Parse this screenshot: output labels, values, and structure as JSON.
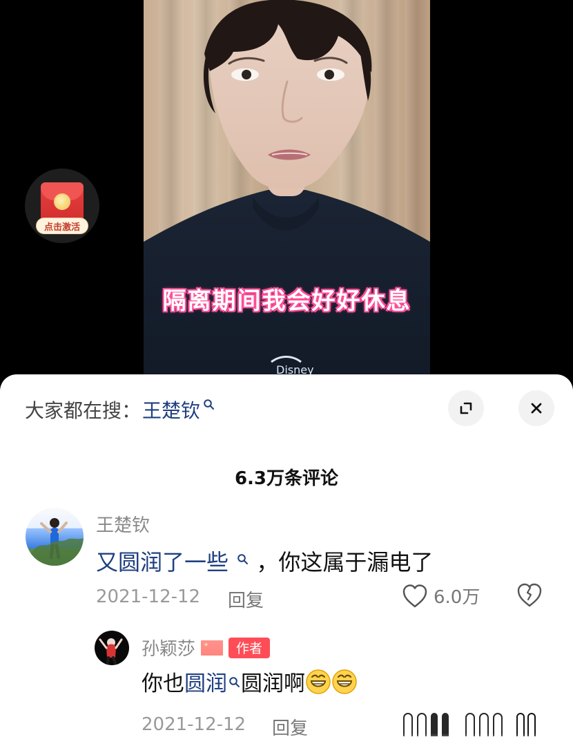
{
  "video": {
    "caption": "隔离期间我会好好休息"
  },
  "red_packet": {
    "label": "点击激活"
  },
  "panel": {
    "search_prefix": "大家都在搜：",
    "search_term": "王楚钦",
    "comment_count": "6.3万条评论"
  },
  "comment": {
    "username": "王楚钦",
    "highlight": "又圆润了一些",
    "rest": "，你这属于漏电了",
    "date": "2021-12-12",
    "reply_label": "回复",
    "like_count": "6.0万"
  },
  "reply": {
    "username": "孙颖莎",
    "author_badge": "作者",
    "text_prefix": "你也",
    "highlight": "圆润",
    "text_suffix": "圆润啊",
    "date": "2021-12-12",
    "reply_label": "回复"
  },
  "colors": {
    "caption_glow": "#ff4f9a",
    "link_blue": "#1f3f81",
    "badge_red": "#ff4d57"
  },
  "icons": {
    "expand": "expand-icon",
    "close": "close-icon",
    "search": "search-icon",
    "heart": "heart-icon",
    "dislike": "broken-heart-icon",
    "emoji": "grinning-face-icon"
  }
}
